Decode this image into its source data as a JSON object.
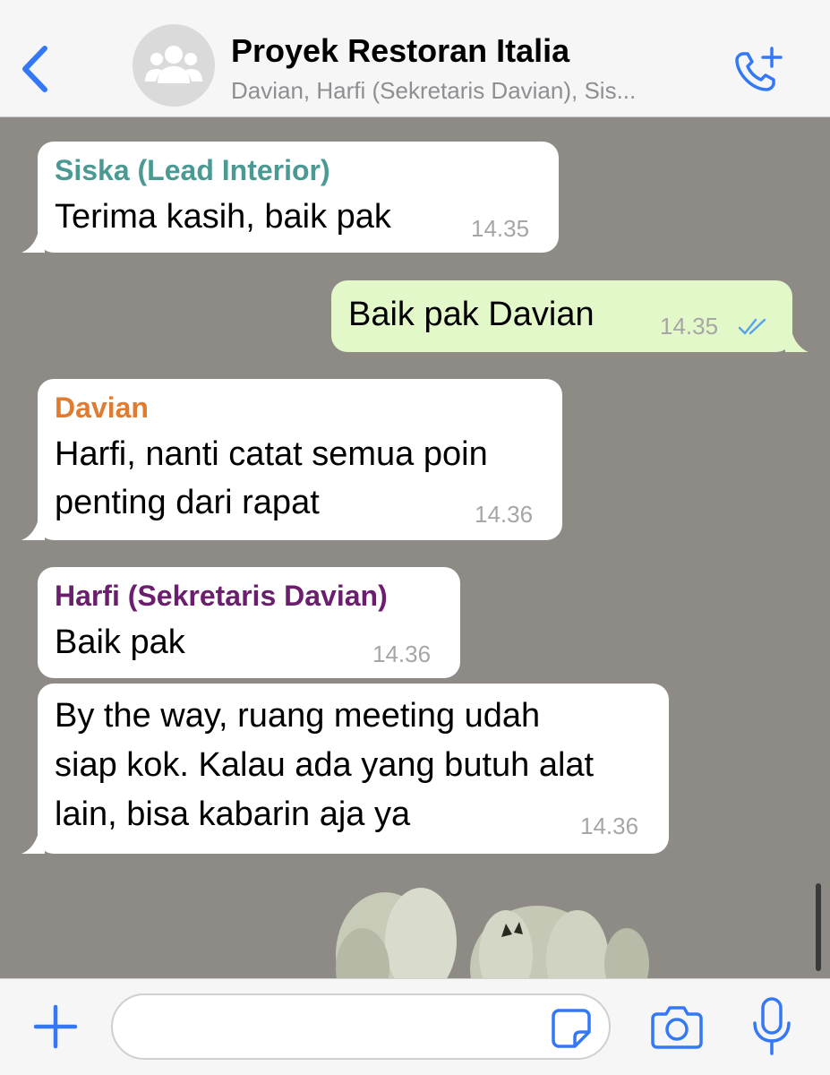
{
  "header": {
    "title": "Proyek Restoran Italia",
    "subtitle": "Davian, Harfi (Sekretaris Davian), Sis..."
  },
  "colors": {
    "accent": "#3478f6",
    "chat_background": "#8e8b86",
    "incoming_bubble": "#ffffff",
    "outgoing_bubble": "#e2f8c8",
    "sender_siska": "#4a9a93",
    "sender_davian": "#e07b2f",
    "sender_harfi": "#6b1d6e"
  },
  "messages": [
    {
      "sender": "Siska (Lead Interior)",
      "lines": [
        "Terima kasih, baik pak"
      ],
      "time": "14.35",
      "direction": "incoming"
    },
    {
      "sender": "",
      "lines": [
        "Baik pak Davian"
      ],
      "time": "14.35",
      "direction": "outgoing",
      "status": "read"
    },
    {
      "sender": "Davian",
      "lines": [
        "Harfi, nanti catat semua poin",
        "penting dari rapat"
      ],
      "time": "14.36",
      "direction": "incoming"
    },
    {
      "sender": "Harfi (Sekretaris Davian)",
      "lines": [
        "Baik pak"
      ],
      "time": "14.36",
      "direction": "incoming"
    },
    {
      "sender": "",
      "lines": [
        "By the way, ruang meeting udah",
        "siap kok. Kalau ada yang butuh alat",
        "lain, bisa kabarin aja ya"
      ],
      "time": "14.36",
      "direction": "incoming"
    }
  ],
  "composer": {
    "placeholder": ""
  },
  "icons": {
    "back": "chevron-left-icon",
    "avatar": "group-icon",
    "call": "phone-plus-icon",
    "attach": "plus-icon",
    "sticker": "sticker-icon",
    "camera": "camera-icon",
    "mic": "microphone-icon"
  }
}
